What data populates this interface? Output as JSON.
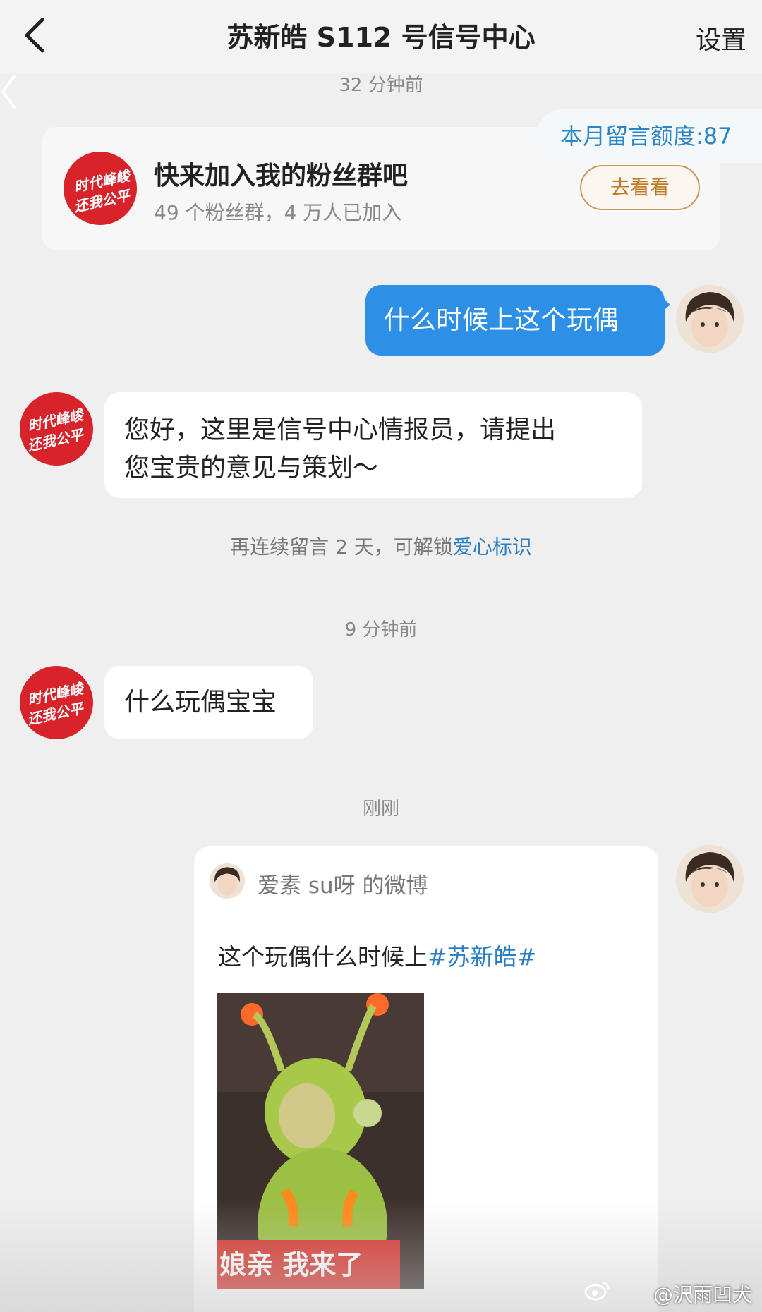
{
  "header": {
    "title": "苏新皓 S112 号信号中心",
    "settings_label": "设置"
  },
  "quota": {
    "text": "本月留言额度:87"
  },
  "fan_group_card": {
    "title": "快来加入我的粉丝群吧",
    "subtitle": "49 个粉丝群，4 万人已加入",
    "button_label": "去看看",
    "logo_line1": "时代峰峻",
    "logo_line2": "还我公平"
  },
  "messages": {
    "ts1": "32 分钟前",
    "user_msg1": "什么时候上这个玩偶",
    "bot_msg1_line1": "您好，这里是信号中心情报员，请提出",
    "bot_msg1_line2": "您宝贵的意见与策划～",
    "tip_prefix": "再连续留言 2 天，可解锁",
    "tip_highlight": "爱心标识",
    "ts2": "9 分钟前",
    "bot_msg2": "什么玩偶宝宝",
    "ts3": "刚刚"
  },
  "shared_post": {
    "author": "爱素 su呀 的微博",
    "text": "这个玩偶什么时候上",
    "hashtag": "#苏新皓#",
    "image_caption": "娘亲 我来了"
  },
  "watermark": {
    "text": "@沢雨凹犬"
  },
  "colors": {
    "accent_blue": "#2d8fe6",
    "link_blue": "#2a7ec4",
    "logo_red": "#d8232a",
    "button_gold": "#c07a26"
  },
  "icons": [
    "back-icon",
    "chevron-left-icon",
    "weibo-icon"
  ]
}
